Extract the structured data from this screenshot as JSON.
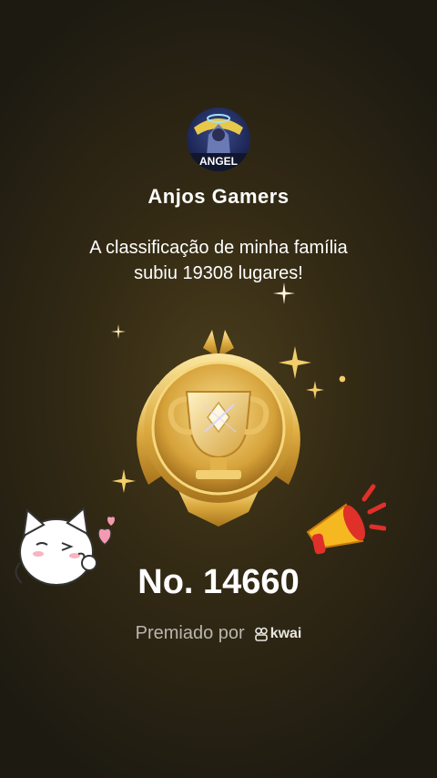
{
  "family": {
    "avatar_text": "ANGEL",
    "name": "Anjos Gamers"
  },
  "message": {
    "line1": "A classificação de minha família",
    "line2": "subiu 19308 lugares!"
  },
  "rank": {
    "label": "No. 14660"
  },
  "awarded": {
    "label": "Premiado por",
    "brand": "kwai"
  },
  "icons": {
    "trophy": "trophy-badge-icon",
    "cat": "cat-kiss-sticker",
    "megaphone": "megaphone-icon",
    "sparkle": "sparkle-icon",
    "brand_logo": "kwai-logo-icon"
  },
  "colors": {
    "gold_light": "#f7dd8a",
    "gold_mid": "#d9a93c",
    "gold_dark": "#9a6a18",
    "megaphone_yellow": "#f6b820",
    "megaphone_red": "#e0302a"
  }
}
